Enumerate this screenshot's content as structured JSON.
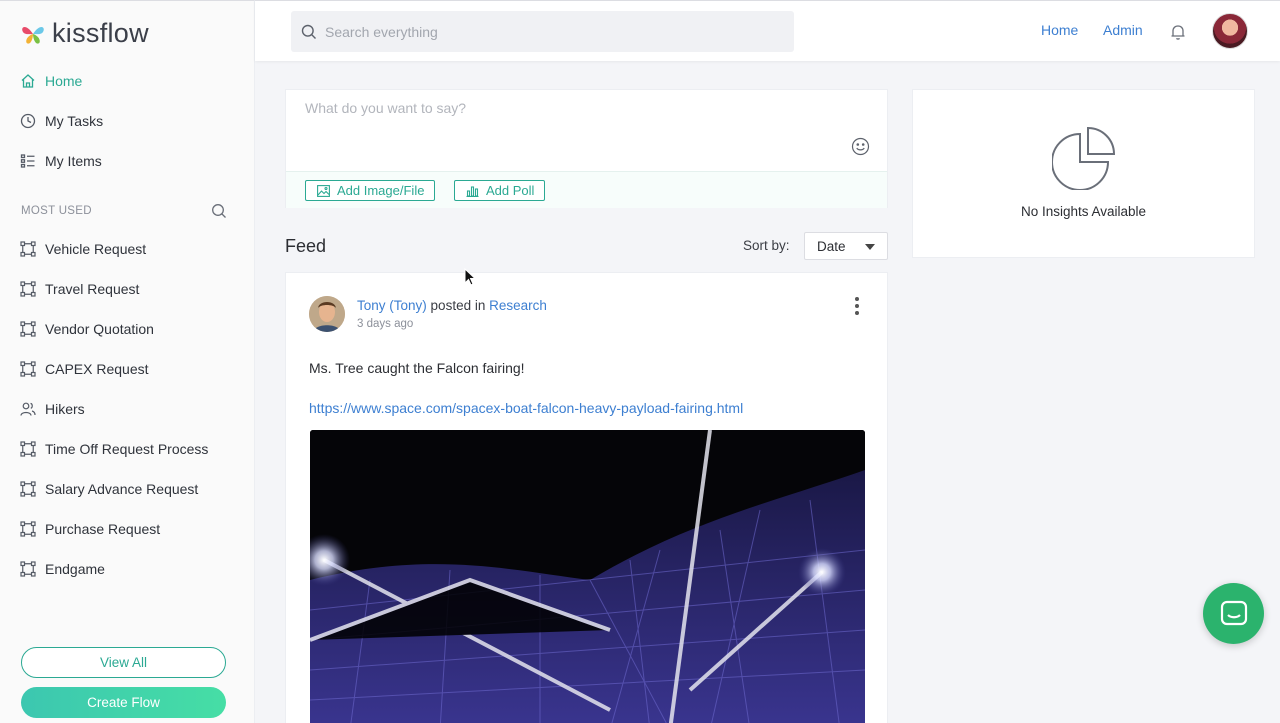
{
  "app": {
    "name": "kissflow",
    "brand_color": "#2ba993",
    "link_color": "#3d7fd1"
  },
  "sidebar": {
    "nav": [
      {
        "label": "Home",
        "icon": "home-icon",
        "active": true
      },
      {
        "label": "My Tasks",
        "icon": "clock-icon",
        "active": false
      },
      {
        "label": "My Items",
        "icon": "list-icon",
        "active": false
      }
    ],
    "section_title": "MOST USED",
    "flows": [
      {
        "label": "Vehicle Request",
        "icon": "flow-icon"
      },
      {
        "label": "Travel Request",
        "icon": "flow-icon"
      },
      {
        "label": "Vendor Quotation",
        "icon": "flow-icon"
      },
      {
        "label": "CAPEX Request",
        "icon": "flow-icon"
      },
      {
        "label": "Hikers",
        "icon": "people-icon"
      },
      {
        "label": "Time Off Request Process",
        "icon": "flow-icon"
      },
      {
        "label": "Salary Advance Request",
        "icon": "flow-icon"
      },
      {
        "label": "Purchase Request",
        "icon": "flow-icon"
      },
      {
        "label": "Endgame",
        "icon": "flow-icon"
      }
    ],
    "view_all_label": "View All",
    "create_flow_label": "Create Flow"
  },
  "topbar": {
    "search_placeholder": "Search everything",
    "home_link": "Home",
    "admin_link": "Admin"
  },
  "composer": {
    "placeholder": "What do you want to say?",
    "add_image_label": "Add Image/File",
    "add_poll_label": "Add Poll"
  },
  "feed": {
    "title": "Feed",
    "sort_label": "Sort by:",
    "sort_value": "Date"
  },
  "post": {
    "author": "Tony (Tony)",
    "posted_in_text": "posted in",
    "group": "Research",
    "time": "3 days ago",
    "text": "Ms. Tree caught the Falcon fairing!",
    "link": "https://www.space.com/spacex-boat-falcon-heavy-payload-fairing.html"
  },
  "insights": {
    "empty_text": "No Insights Available"
  }
}
